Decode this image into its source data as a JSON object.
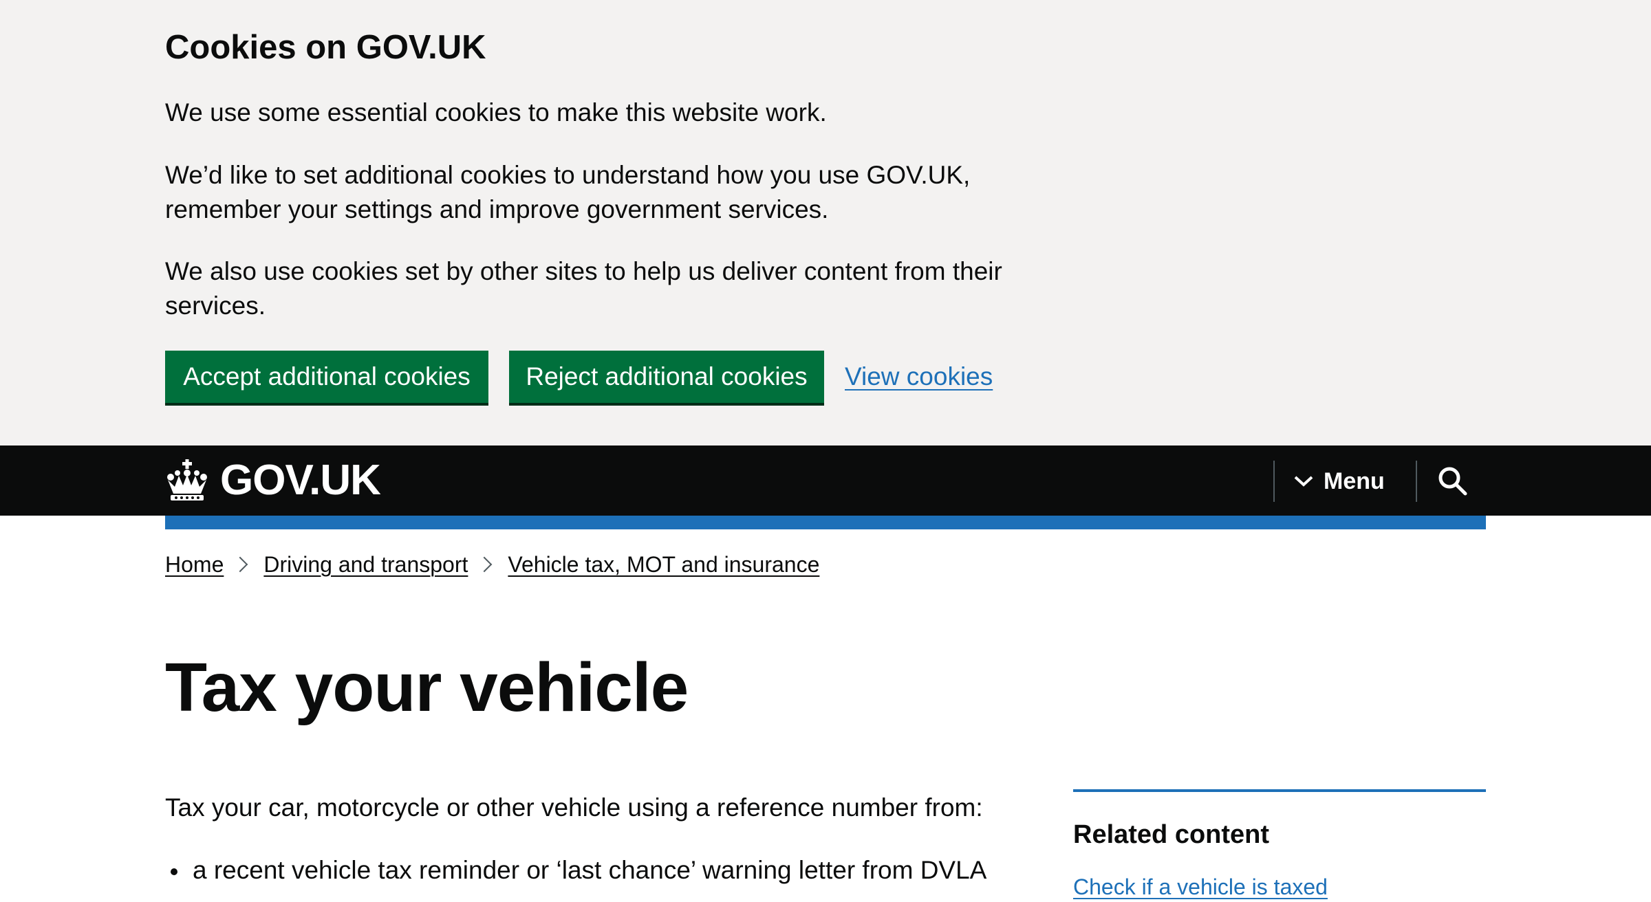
{
  "cookie_banner": {
    "title": "Cookies on GOV.UK",
    "paragraphs": [
      "We use some essential cookies to make this website work.",
      "We’d like to set additional cookies to understand how you use GOV.UK, remember your settings and improve government services.",
      "We also use cookies set by other sites to help us deliver content from their services."
    ],
    "accept_label": "Accept additional cookies",
    "reject_label": "Reject additional cookies",
    "view_label": "View cookies"
  },
  "header": {
    "logo_text": "GOV.UK",
    "logo_icon": "crown-icon",
    "menu_label": "Menu",
    "menu_icon": "chevron-down-icon",
    "search_icon": "search-icon"
  },
  "breadcrumb": [
    "Home",
    "Driving and transport",
    "Vehicle tax, MOT and insurance"
  ],
  "main": {
    "title": "Tax your vehicle",
    "intro": "Tax your car, motorcycle or other vehicle using a reference number from:",
    "bullets": [
      "a recent vehicle tax reminder or ‘last chance’ warning letter from DVLA"
    ]
  },
  "related": {
    "title": "Related content",
    "links": [
      "Check if a vehicle is taxed"
    ]
  },
  "colors": {
    "banner_bg": "#f3f2f1",
    "button_green": "#00703c",
    "link_blue": "#1d70b8",
    "header_black": "#0b0c0c",
    "text": "#0b0c0c"
  }
}
